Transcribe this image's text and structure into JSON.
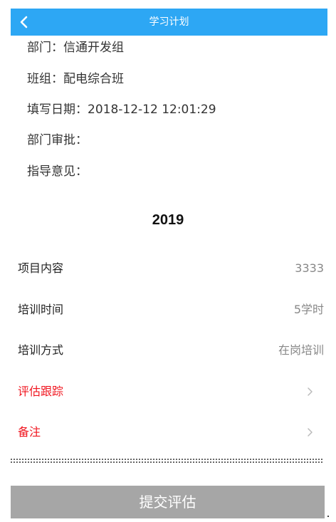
{
  "header": {
    "title": "学习计划",
    "back_icon": "chevron-left-icon",
    "bg_color": "#2da7f4"
  },
  "info": {
    "department": "部门：信通开发组",
    "team": "班组：配电综合班",
    "fill_date": "填写日期：2018-12-12 12:01:29",
    "dept_approval": "部门审批：",
    "guidance": "指导意见："
  },
  "year": "2019",
  "rows": [
    {
      "label": "项目内容",
      "value": "3333"
    },
    {
      "label": "培训时间",
      "value": "5学时"
    },
    {
      "label": "培训方式",
      "value": "在岗培训"
    },
    {
      "label": "评估跟踪",
      "icon": "chevron-right-icon",
      "label_color": "#f0141e"
    },
    {
      "label": "备注",
      "icon": "chevron-right-icon",
      "label_color": "#f0141e"
    }
  ],
  "submit": {
    "label": "提交评估",
    "bg_color": "#a6a6a6"
  }
}
